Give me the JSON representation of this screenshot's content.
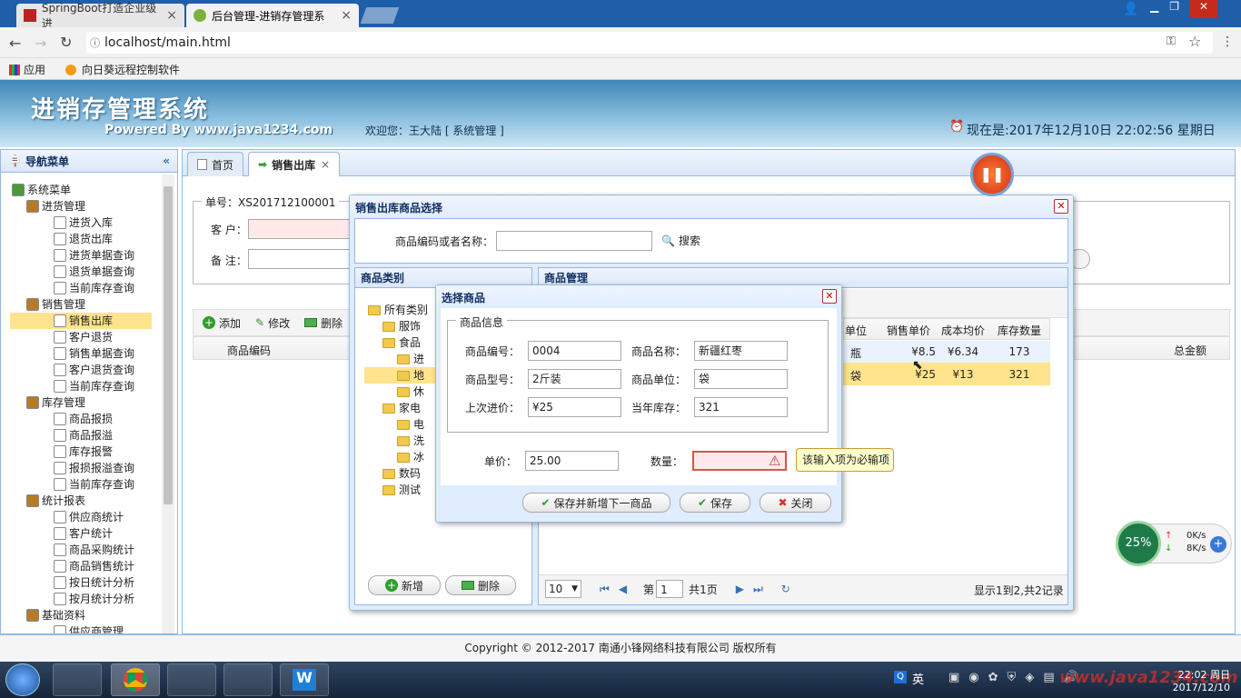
{
  "browser": {
    "tabs": [
      {
        "label": "SpringBoot打造企业级进"
      },
      {
        "label": "后台管理-进销存管理系"
      }
    ],
    "address": "localhost/main.html",
    "bookmarks": [
      {
        "label": "应用"
      },
      {
        "label": "向日葵远程控制软件"
      }
    ]
  },
  "header": {
    "title": "进销存管理系统",
    "powered": "Powered By www.java1234.com",
    "welcome": "欢迎您：王大陆 [ 系统管理 ]",
    "clock": "现在是:2017年12月10日 22:02:56 星期日"
  },
  "nav": {
    "title": "导航菜单",
    "items": [
      {
        "label": "系统菜单",
        "level": 0
      },
      {
        "label": "进货管理",
        "level": 1
      },
      {
        "label": "进货入库",
        "level": 2
      },
      {
        "label": "退货出库",
        "level": 2
      },
      {
        "label": "进货单据查询",
        "level": 2
      },
      {
        "label": "退货单据查询",
        "level": 2
      },
      {
        "label": "当前库存查询",
        "level": 2
      },
      {
        "label": "销售管理",
        "level": 1
      },
      {
        "label": "销售出库",
        "level": 2,
        "selected": true
      },
      {
        "label": "客户退货",
        "level": 2
      },
      {
        "label": "销售单据查询",
        "level": 2
      },
      {
        "label": "客户退货查询",
        "level": 2
      },
      {
        "label": "当前库存查询",
        "level": 2
      },
      {
        "label": "库存管理",
        "level": 1
      },
      {
        "label": "商品报损",
        "level": 2
      },
      {
        "label": "商品报溢",
        "level": 2
      },
      {
        "label": "库存报警",
        "level": 2
      },
      {
        "label": "报损报溢查询",
        "level": 2
      },
      {
        "label": "当前库存查询",
        "level": 2
      },
      {
        "label": "统计报表",
        "level": 1
      },
      {
        "label": "供应商统计",
        "level": 2
      },
      {
        "label": "客户统计",
        "level": 2
      },
      {
        "label": "商品采购统计",
        "level": 2
      },
      {
        "label": "商品销售统计",
        "level": 2
      },
      {
        "label": "按日统计分析",
        "level": 2
      },
      {
        "label": "按月统计分析",
        "level": 2
      },
      {
        "label": "基础资料",
        "level": 1
      },
      {
        "label": "供应商管理",
        "level": 2
      }
    ]
  },
  "main": {
    "tabs": [
      {
        "label": "首页"
      },
      {
        "label": "销售出库"
      }
    ],
    "order_no": "单号：XS201712100001",
    "customer_label": "客 户：",
    "remark_label": "备 注：",
    "toolbar": {
      "add": "添加",
      "edit": "修改",
      "delete": "删除"
    },
    "grid_cols": {
      "code": "商品编码",
      "total": "总金额"
    }
  },
  "picker": {
    "title": "销售出库商品选择",
    "search_label": "商品编码或者名称：",
    "search_value": "",
    "search_button": "搜索",
    "category_title": "商品类别",
    "goods_title": "商品管理",
    "tree": [
      {
        "label": "所有类别"
      },
      {
        "label": "服饰"
      },
      {
        "label": "食品"
      },
      {
        "label": "进"
      },
      {
        "label": "地"
      },
      {
        "label": "休"
      },
      {
        "label": "家电"
      },
      {
        "label": "电"
      },
      {
        "label": "洗"
      },
      {
        "label": "冰"
      },
      {
        "label": "数码"
      },
      {
        "label": "测试"
      }
    ],
    "add_button": "新增",
    "delete_button": "删除",
    "columns": [
      "单位",
      "销售单价",
      "成本均价",
      "库存数量"
    ],
    "rows": [
      {
        "unit": "瓶",
        "price": "¥8.5",
        "cost": "¥6.34",
        "stock": "173"
      },
      {
        "unit": "袋",
        "price": "¥25",
        "cost": "¥13",
        "stock": "321"
      }
    ],
    "pager": {
      "size": "10",
      "page_prefix": "第",
      "page": "1",
      "page_suffix": "共1页",
      "summary": "显示1到2,共2记录"
    }
  },
  "select": {
    "title": "选择商品",
    "legend": "商品信息",
    "fields": {
      "code_label": "商品编号：",
      "code": "0004",
      "name_label": "商品名称：",
      "name": "新疆红枣",
      "model_label": "商品型号：",
      "model": "2斤装",
      "unit_label": "商品单位：",
      "unit": "袋",
      "last_price_label": "上次进价：",
      "last_price": "¥25",
      "stock_label": "当年库存：",
      "stock": "321",
      "price_label": "单价：",
      "price": "25.00",
      "qty_label": "数量：",
      "qty": ""
    },
    "tooltip": "该输入项为必输项",
    "buttons": {
      "save_next": "保存并新增下一商品",
      "save": "保存",
      "close": "关闭"
    }
  },
  "footer": "Copyright © 2012-2017 南通小锋网络科技有限公司 版权所有",
  "widget": {
    "percent": "25%",
    "up": "0K/s",
    "down": "8K/s"
  },
  "tray": {
    "ime": "英",
    "time": "22:02 周日",
    "date": "2017/12/10",
    "watermark": "www.java1234.com"
  }
}
